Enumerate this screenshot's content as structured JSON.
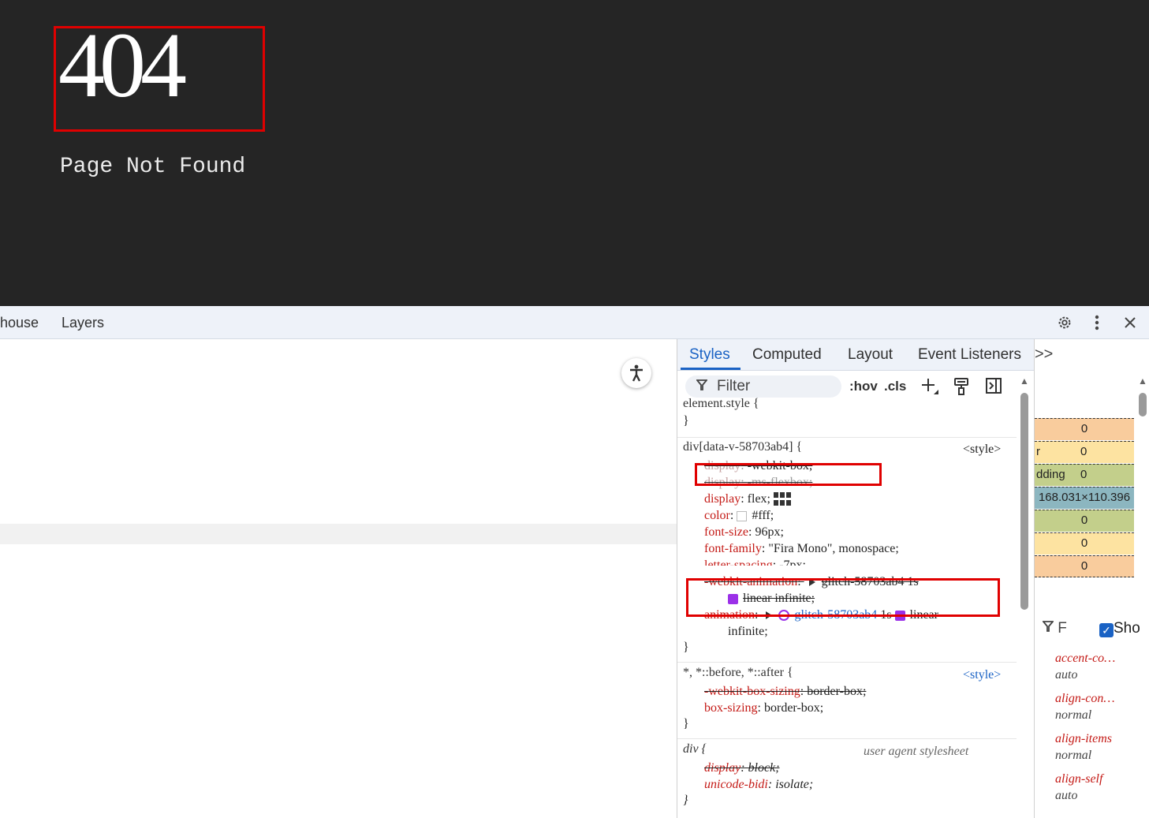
{
  "page": {
    "heading": "404",
    "subheading": "Page Not Found"
  },
  "devtools_toolbar": {
    "tabs": [
      "house",
      "Layers"
    ],
    "icons": [
      "gear-icon",
      "more-vert-icon",
      "close-icon"
    ]
  },
  "styles_pane": {
    "tabs": [
      "Styles",
      "Computed",
      "Layout",
      "Event Listeners",
      ">>"
    ],
    "filter_placeholder": "Filter",
    "hov_label": ":hov",
    "cls_label": ".cls",
    "rules": {
      "element_style": {
        "selector": "element.style {",
        "close": "}"
      },
      "rule1": {
        "selector": "div[data-v-58703ab4] {",
        "source": "<style>",
        "decls": [
          {
            "prop": "display",
            "value": "-webkit-box;"
          },
          {
            "prop": "display",
            "value": "-ms-flexbox;"
          },
          {
            "prop": "display",
            "value": "flex;"
          },
          {
            "prop": "color",
            "value": "#fff;"
          },
          {
            "prop": "font-size",
            "value": "96px;"
          },
          {
            "prop": "font-family",
            "value": "\"Fira Mono\", monospace;"
          },
          {
            "prop": "letter-spacing",
            "value": "-7px;"
          },
          {
            "prop": "-webkit-animation",
            "value": "glitch-58703ab4 1s",
            "cont": "linear infinite;"
          },
          {
            "prop": "animation",
            "value_link": "glitch-58703ab4",
            "value": "1s",
            "value2": "linear",
            "cont": "infinite;"
          }
        ],
        "close": "}"
      },
      "rule2": {
        "selector": "*, *::before, *::after {",
        "source": "<style>",
        "decls": [
          {
            "prop": "-webkit-box-sizing",
            "value": "border-box;"
          },
          {
            "prop": "box-sizing",
            "value": "border-box;"
          }
        ],
        "close": "}"
      },
      "rule3": {
        "selector": "div {",
        "source": "user agent stylesheet",
        "decls": [
          {
            "prop": "display",
            "value": "block;"
          },
          {
            "prop": "unicode-bidi",
            "value": "isolate;"
          }
        ],
        "close": "}"
      }
    }
  },
  "box_model": {
    "rows": [
      {
        "label": "",
        "value": "0"
      },
      {
        "label": "r",
        "value": "0"
      },
      {
        "label": "dding",
        "value": "0"
      },
      {
        "label": "",
        "value": "168.031×110.396"
      },
      {
        "label": "",
        "value": "0"
      },
      {
        "label": "",
        "value": "0"
      },
      {
        "label": "",
        "value": "0"
      }
    ]
  },
  "computed": {
    "filter_label": "F",
    "show_all_label": "Sho",
    "props": [
      {
        "name": "accent-co…",
        "value": "auto"
      },
      {
        "name": "align-con…",
        "value": "normal"
      },
      {
        "name": "align-items",
        "value": "normal"
      },
      {
        "name": "align-self",
        "value": "auto"
      }
    ]
  },
  "colors": {
    "page_bg": "#252525",
    "margin": "#f9cc9d",
    "border": "#fde3a1",
    "padding": "#c3cf8b",
    "content": "#8cb6c0",
    "highlight": "#e00000"
  }
}
